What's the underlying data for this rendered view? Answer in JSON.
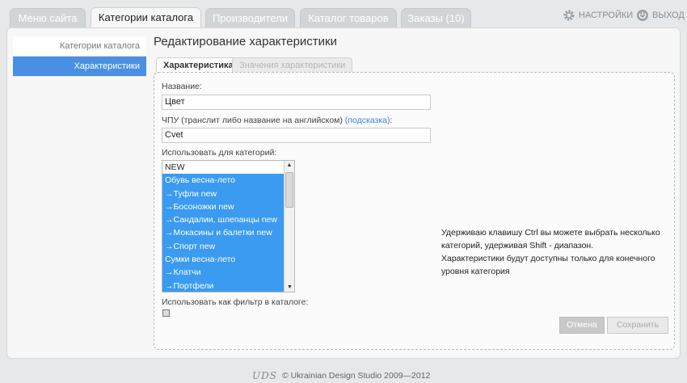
{
  "topnav": {
    "tabs": [
      "Меню сайта",
      "Категории каталога",
      "Производители",
      "Каталог товаров",
      "Заказы (10)"
    ],
    "settings_label": "НАСТРОЙКИ",
    "logout_label": "ВЫХОД"
  },
  "sidebar": {
    "items": [
      "Категории каталога",
      "Характеристики"
    ]
  },
  "page": {
    "title": "Редактирование характеристики",
    "tabs": [
      "Характеристика",
      "Значения характеристики"
    ]
  },
  "form": {
    "name_label": "Название:",
    "name_value": "Цвет",
    "slug_label": "ЧПУ (транслит либо название на английском)",
    "slug_hint_link": "(подсказка)",
    "slug_colon": ":",
    "slug_value": "Cvet",
    "categories_label": "Использовать для категорий:",
    "categories": [
      {
        "label": "NEW",
        "selected": false
      },
      {
        "label": "Обувь весна-лето",
        "selected": true
      },
      {
        "label": "→Туфли new",
        "selected": true
      },
      {
        "label": "→Босоножки new",
        "selected": true
      },
      {
        "label": "→Сандалии, шлепанцы new",
        "selected": true
      },
      {
        "label": "→Мокасины и балетки new",
        "selected": true
      },
      {
        "label": "→Спорт new",
        "selected": true
      },
      {
        "label": "Сумки весна-лето",
        "selected": true
      },
      {
        "label": "→Клатчи",
        "selected": true
      },
      {
        "label": "→Портфели",
        "selected": true
      }
    ],
    "hint_line1": "Удерживаю клавишу Ctrl вы можете выбрать несколько категорий, удерживая Shift - диапазон.",
    "hint_line2": "Характеристики будут доступны только для конечного уровня категория",
    "filter_label": "Использовать как фильтр в каталоге:",
    "cancel_label": "Отмена",
    "save_label": "Сохранить"
  },
  "footer": {
    "logo_text": "UDS",
    "copyright": "© Ukrainian Design Studio 2009—2012"
  },
  "colors": {
    "accent": "#4a90e2",
    "selection": "#3a9bf0",
    "link": "#3b82d6",
    "background": "#e6e8e9"
  }
}
